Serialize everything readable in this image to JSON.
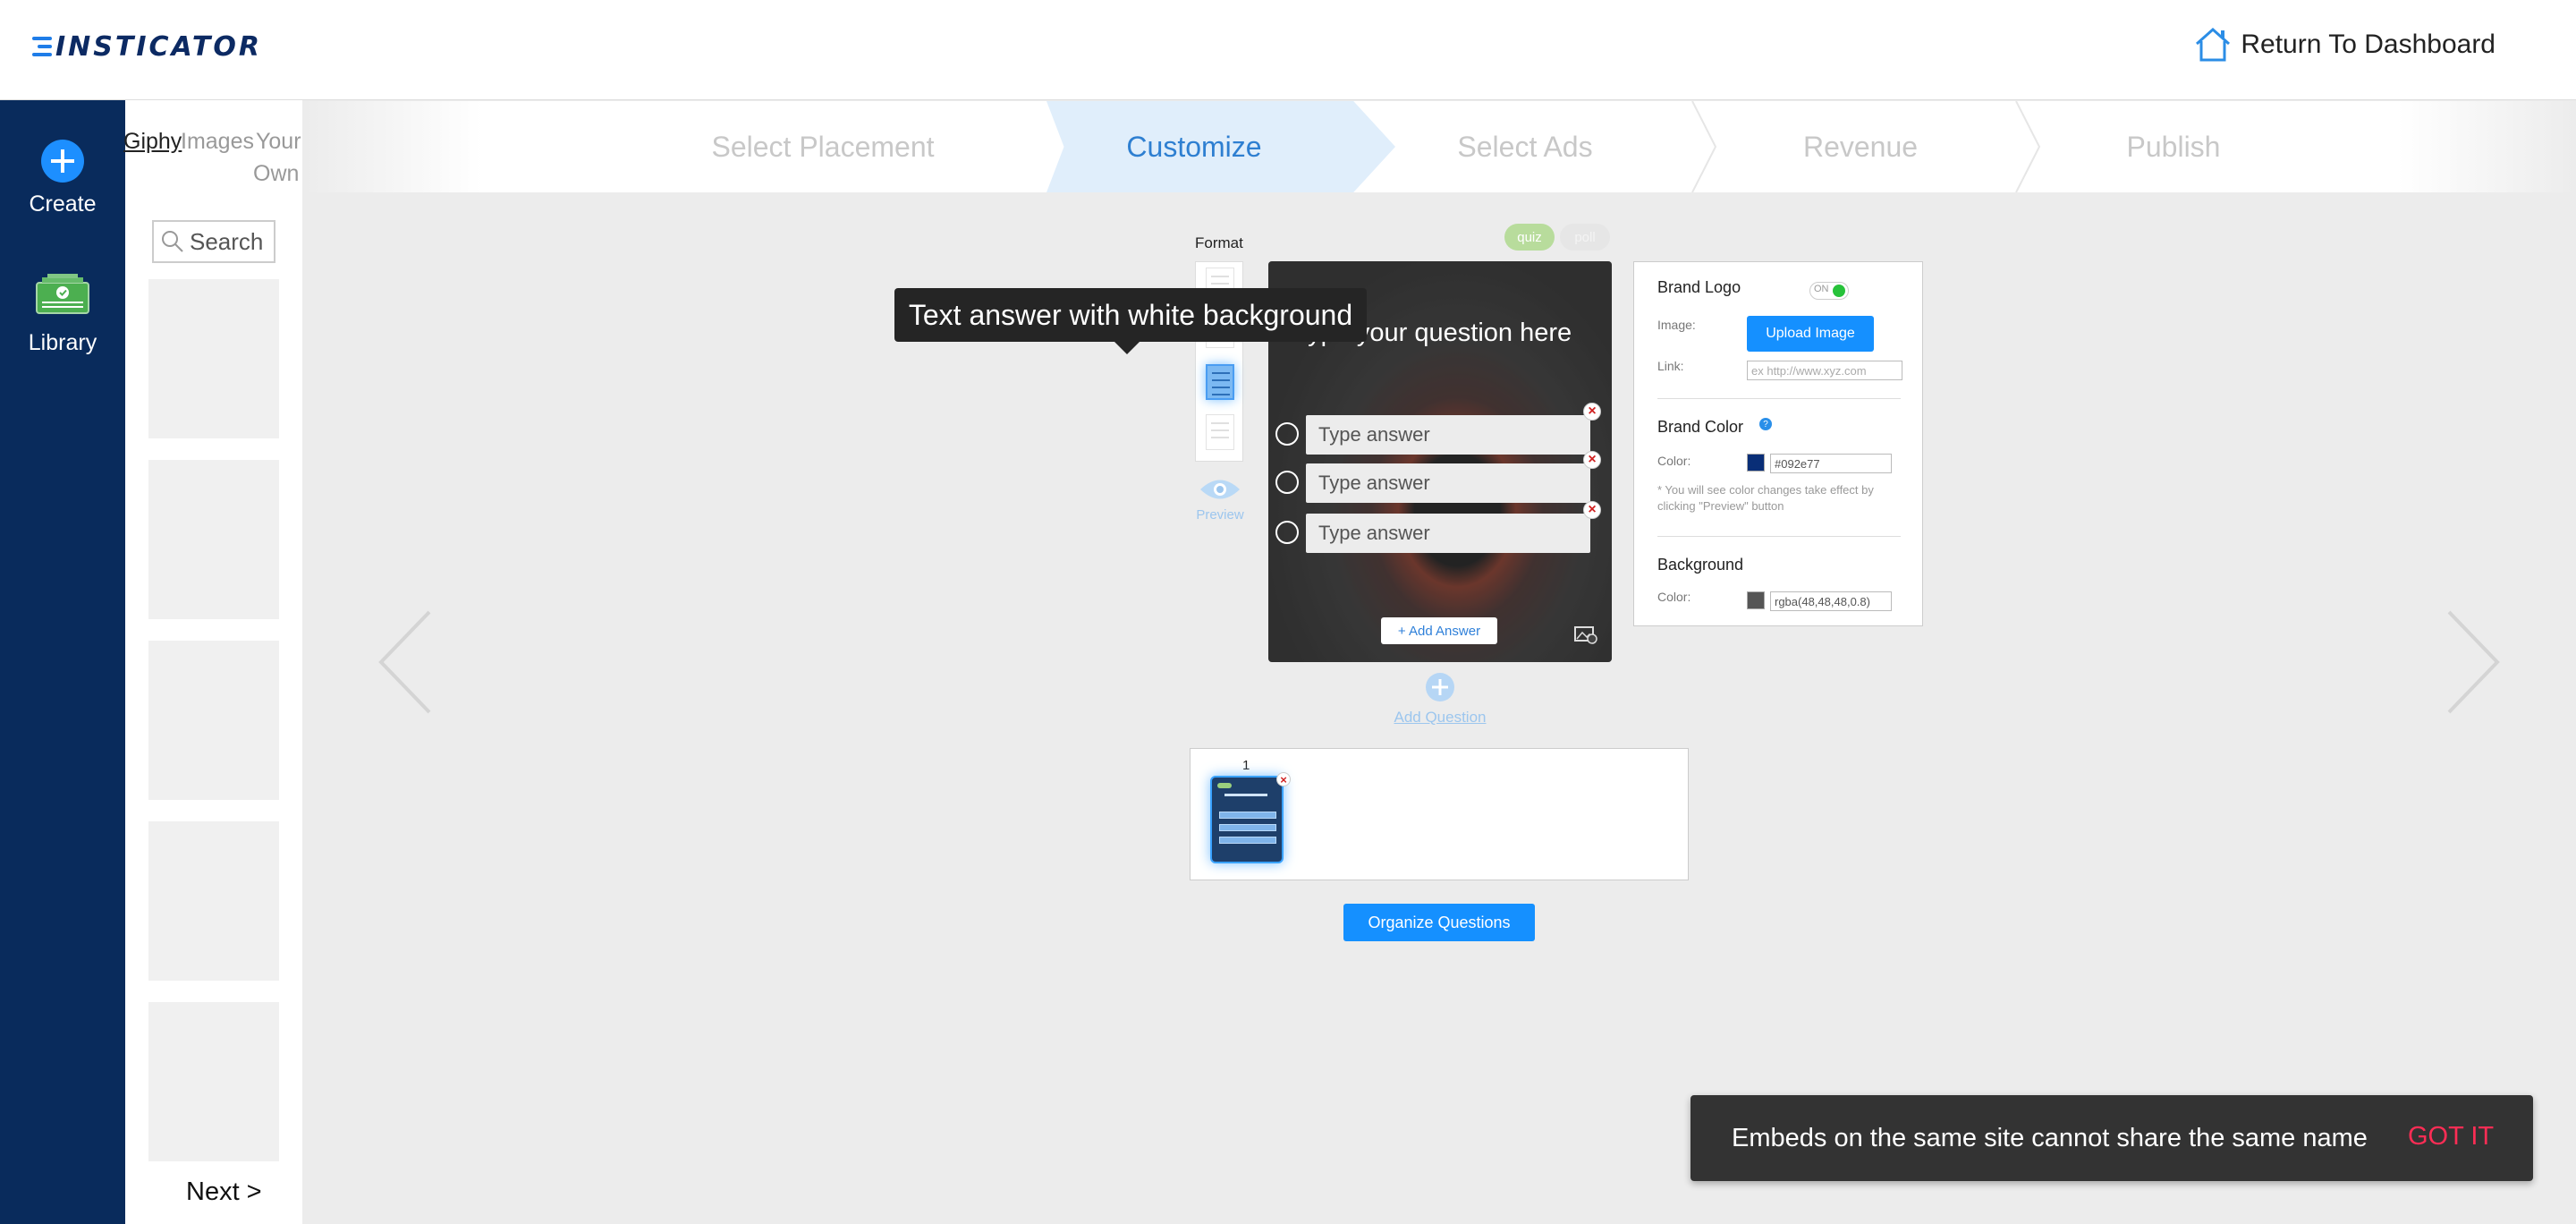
{
  "header": {
    "brand": "INSTICATOR",
    "return_label": "Return To Dashboard",
    "return_icon": "home-icon"
  },
  "leftnav": {
    "items": [
      {
        "label": "Create",
        "icon": "plus-circle-icon"
      },
      {
        "label": "Library",
        "icon": "library-icon"
      }
    ]
  },
  "media_panel": {
    "tabs": [
      "Giphy",
      "Images",
      "Your",
      "Own"
    ],
    "search_placeholder": "Search",
    "next_label": "Next >"
  },
  "steps": {
    "items": [
      "Select Placement",
      "Customize",
      "Select Ads",
      "Revenue",
      "Publish"
    ],
    "active": "Customize"
  },
  "editor": {
    "format_label": "Format",
    "preview_label": "Preview",
    "type_pills": [
      "quiz",
      "poll"
    ],
    "question_placeholder": "Type your question here",
    "answers": [
      "Type answer",
      "Type answer",
      "Type answer"
    ],
    "add_answer_label": "+ Add Answer",
    "add_question_label": "Add Question",
    "tooltip": "Text answer with white background"
  },
  "settings": {
    "brand_logo_title": "Brand Logo",
    "toggle_label": "ON",
    "image_label": "Image:",
    "upload_label": "Upload Image",
    "link_label": "Link:",
    "link_placeholder": "ex http://www.xyz.com",
    "brand_color_title": "Brand Color",
    "color_label": "Color:",
    "brand_color_value": "#092e77",
    "brand_color_swatch": "#092e77",
    "note": "* You will see color changes take effect by clicking \"Preview\" button",
    "background_title": "Background",
    "bg_color_label": "Color:",
    "bg_color_value": "rgba(48,48,48,0.8)",
    "bg_color_swatch": "#555555",
    "help_glyph": "?"
  },
  "questions_strip": {
    "number": "1",
    "organize_label": "Organize Questions"
  },
  "snackbar": {
    "message": "Embeds on the same site cannot share the same name",
    "action": "GOT IT"
  },
  "colors": {
    "nav_bg": "#092b5c",
    "primary_button": "#1590ff",
    "active_step": "#2e7fd1",
    "snackbar_action": "#ff2d55"
  }
}
